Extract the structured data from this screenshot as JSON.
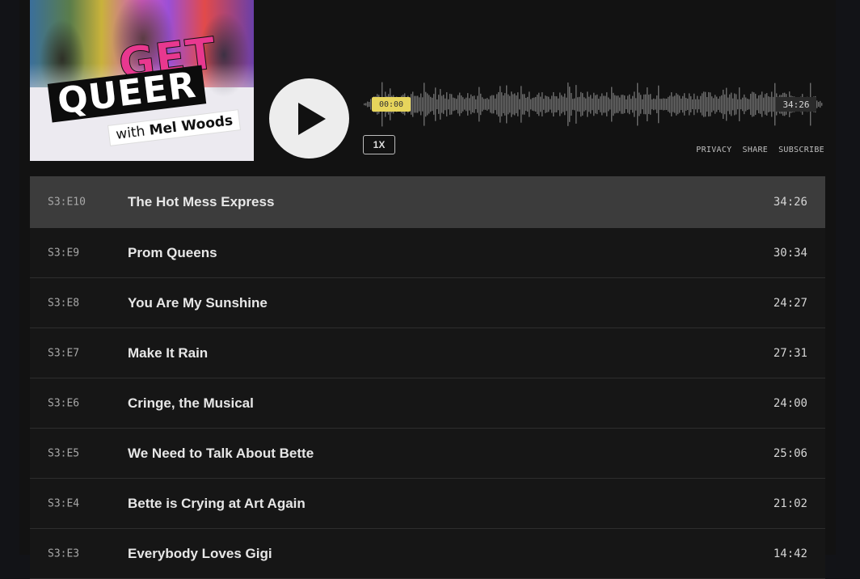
{
  "podcast": {
    "art_title_line1": "GET",
    "art_title_line2": "QUEER",
    "art_host_prefix": "with",
    "art_host_name": "Mel Woods"
  },
  "player": {
    "current_time": "00:00",
    "duration": "34:26",
    "speed": "1X",
    "progress": 0,
    "links": [
      "PRIVACY",
      "SHARE",
      "SUBSCRIBE"
    ]
  },
  "episodes": [
    {
      "code": "S3:E10",
      "title": "The Hot Mess Express",
      "duration": "34:26",
      "active": true
    },
    {
      "code": "S3:E9",
      "title": "Prom Queens",
      "duration": "30:34"
    },
    {
      "code": "S3:E8",
      "title": "You Are My Sunshine",
      "duration": "24:27"
    },
    {
      "code": "S3:E7",
      "title": "Make It Rain",
      "duration": "27:31"
    },
    {
      "code": "S3:E6",
      "title": "Cringe, the Musical",
      "duration": "24:00"
    },
    {
      "code": "S3:E5",
      "title": "We Need to Talk About Bette",
      "duration": "25:06"
    },
    {
      "code": "S3:E4",
      "title": "Bette is Crying at Art Again",
      "duration": "21:02"
    },
    {
      "code": "S3:E3",
      "title": "Everybody Loves Gigi",
      "duration": "14:42"
    }
  ],
  "colors": {
    "background": "#121212",
    "active_row": "#3c3c3c",
    "time_badge": "#e7d55c",
    "logo_pink": "#e8388f"
  },
  "icons": {
    "play": "play-icon"
  }
}
